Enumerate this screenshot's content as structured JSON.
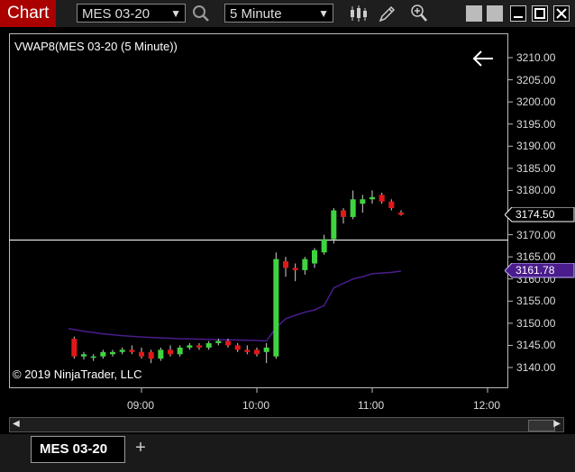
{
  "toolbar": {
    "chart_label": "Chart",
    "instrument": "MES 03-20",
    "interval": "5 Minute"
  },
  "indicator_label": "VWAP8(MES 03-20 (5 Minute))",
  "copyright": "© 2019 NinjaTrader, LLC",
  "tab": {
    "label": "MES 03-20",
    "add_label": "+"
  },
  "colors": {
    "up_candle": "#3fd43f",
    "down_candle": "#e01818",
    "vwap_line": "#4b1c8c",
    "price_tag_last": "#ffffff",
    "price_tag_vwap": "#4b1c8c"
  },
  "chart_data": {
    "type": "candlestick",
    "y_ticks": [
      "3210.00",
      "3205.00",
      "3200.00",
      "3195.00",
      "3190.00",
      "3185.00",
      "3180.00",
      "3175.00",
      "3170.00",
      "3165.00",
      "3160.00",
      "3155.00",
      "3150.00",
      "3145.00",
      "3140.00"
    ],
    "x_ticks": [
      "09:00",
      "10:00",
      "11:00",
      "12:00"
    ],
    "ylim": [
      3137,
      3214
    ],
    "xlim_minutes": [
      492,
      735
    ],
    "horizontal_line": 3168.8,
    "last_price_label": "3174.50",
    "vwap_label": "3161.78",
    "candles": [
      {
        "t": 505,
        "o": 3146.5,
        "h": 3147,
        "l": 3142,
        "c": 3142.5
      },
      {
        "t": 510,
        "o": 3142.5,
        "h": 3143.5,
        "l": 3141.8,
        "c": 3143
      },
      {
        "t": 515,
        "o": 3142.5,
        "h": 3143,
        "l": 3141.5,
        "c": 3142.5
      },
      {
        "t": 520,
        "o": 3142.5,
        "h": 3144,
        "l": 3142,
        "c": 3143.5
      },
      {
        "t": 525,
        "o": 3143,
        "h": 3144,
        "l": 3142.5,
        "c": 3143.5
      },
      {
        "t": 530,
        "o": 3143.5,
        "h": 3144.5,
        "l": 3143,
        "c": 3144
      },
      {
        "t": 535,
        "o": 3144,
        "h": 3145,
        "l": 3143,
        "c": 3143.5
      },
      {
        "t": 540,
        "o": 3143.5,
        "h": 3144.5,
        "l": 3142,
        "c": 3142.5
      },
      {
        "t": 545,
        "o": 3143.5,
        "h": 3144,
        "l": 3141,
        "c": 3142
      },
      {
        "t": 550,
        "o": 3142,
        "h": 3144.5,
        "l": 3141.5,
        "c": 3144
      },
      {
        "t": 555,
        "o": 3144,
        "h": 3145,
        "l": 3142.5,
        "c": 3143
      },
      {
        "t": 560,
        "o": 3143,
        "h": 3145,
        "l": 3142.5,
        "c": 3144.5
      },
      {
        "t": 565,
        "o": 3144.5,
        "h": 3145.5,
        "l": 3144,
        "c": 3145
      },
      {
        "t": 570,
        "o": 3145,
        "h": 3145.5,
        "l": 3144,
        "c": 3144.5
      },
      {
        "t": 575,
        "o": 3144.5,
        "h": 3146,
        "l": 3144,
        "c": 3145.5
      },
      {
        "t": 580,
        "o": 3145.5,
        "h": 3146.5,
        "l": 3145,
        "c": 3146
      },
      {
        "t": 585,
        "o": 3146,
        "h": 3146.5,
        "l": 3144.5,
        "c": 3145
      },
      {
        "t": 590,
        "o": 3145,
        "h": 3145.5,
        "l": 3143.5,
        "c": 3144
      },
      {
        "t": 595,
        "o": 3144,
        "h": 3145,
        "l": 3143,
        "c": 3143.5
      },
      {
        "t": 600,
        "o": 3144,
        "h": 3144.5,
        "l": 3142.5,
        "c": 3143
      },
      {
        "t": 605,
        "o": 3143.5,
        "h": 3145.5,
        "l": 3141,
        "c": 3144.5
      },
      {
        "t": 610,
        "o": 3142.5,
        "h": 3166,
        "l": 3142,
        "c": 3164.5
      },
      {
        "t": 615,
        "o": 3164,
        "h": 3165,
        "l": 3160.5,
        "c": 3162.5
      },
      {
        "t": 620,
        "o": 3162.5,
        "h": 3163.5,
        "l": 3159.5,
        "c": 3162
      },
      {
        "t": 625,
        "o": 3162,
        "h": 3165,
        "l": 3161,
        "c": 3164.5
      },
      {
        "t": 630,
        "o": 3163.5,
        "h": 3167,
        "l": 3162.5,
        "c": 3166.5
      },
      {
        "t": 635,
        "o": 3166,
        "h": 3170,
        "l": 3165.5,
        "c": 3169
      },
      {
        "t": 640,
        "o": 3169,
        "h": 3176,
        "l": 3168,
        "c": 3175.5
      },
      {
        "t": 645,
        "o": 3175.5,
        "h": 3176,
        "l": 3172.5,
        "c": 3174
      },
      {
        "t": 650,
        "o": 3174,
        "h": 3180,
        "l": 3173.5,
        "c": 3178
      },
      {
        "t": 655,
        "o": 3177,
        "h": 3179,
        "l": 3175,
        "c": 3178
      },
      {
        "t": 660,
        "o": 3178,
        "h": 3180,
        "l": 3177,
        "c": 3178.5
      },
      {
        "t": 665,
        "o": 3179,
        "h": 3179.5,
        "l": 3177,
        "c": 3177.5
      },
      {
        "t": 670,
        "o": 3177.5,
        "h": 3178,
        "l": 3175.5,
        "c": 3176
      },
      {
        "t": 675,
        "o": 3175,
        "h": 3175.5,
        "l": 3174.3,
        "c": 3174.5
      }
    ],
    "vwap": [
      {
        "t": 502,
        "v": 3148.8
      },
      {
        "t": 510,
        "v": 3148.2
      },
      {
        "t": 520,
        "v": 3147.6
      },
      {
        "t": 530,
        "v": 3147.2
      },
      {
        "t": 540,
        "v": 3146.9
      },
      {
        "t": 550,
        "v": 3146.7
      },
      {
        "t": 560,
        "v": 3146.5
      },
      {
        "t": 570,
        "v": 3146.4
      },
      {
        "t": 580,
        "v": 3146.3
      },
      {
        "t": 590,
        "v": 3146.2
      },
      {
        "t": 600,
        "v": 3146.1
      },
      {
        "t": 605,
        "v": 3146
      },
      {
        "t": 610,
        "v": 3149
      },
      {
        "t": 615,
        "v": 3151
      },
      {
        "t": 620,
        "v": 3151.8
      },
      {
        "t": 625,
        "v": 3152.5
      },
      {
        "t": 630,
        "v": 3153
      },
      {
        "t": 635,
        "v": 3154
      },
      {
        "t": 640,
        "v": 3158
      },
      {
        "t": 645,
        "v": 3159
      },
      {
        "t": 650,
        "v": 3160
      },
      {
        "t": 655,
        "v": 3160.5
      },
      {
        "t": 660,
        "v": 3161.2
      },
      {
        "t": 670,
        "v": 3161.5
      },
      {
        "t": 675,
        "v": 3161.8
      }
    ]
  }
}
